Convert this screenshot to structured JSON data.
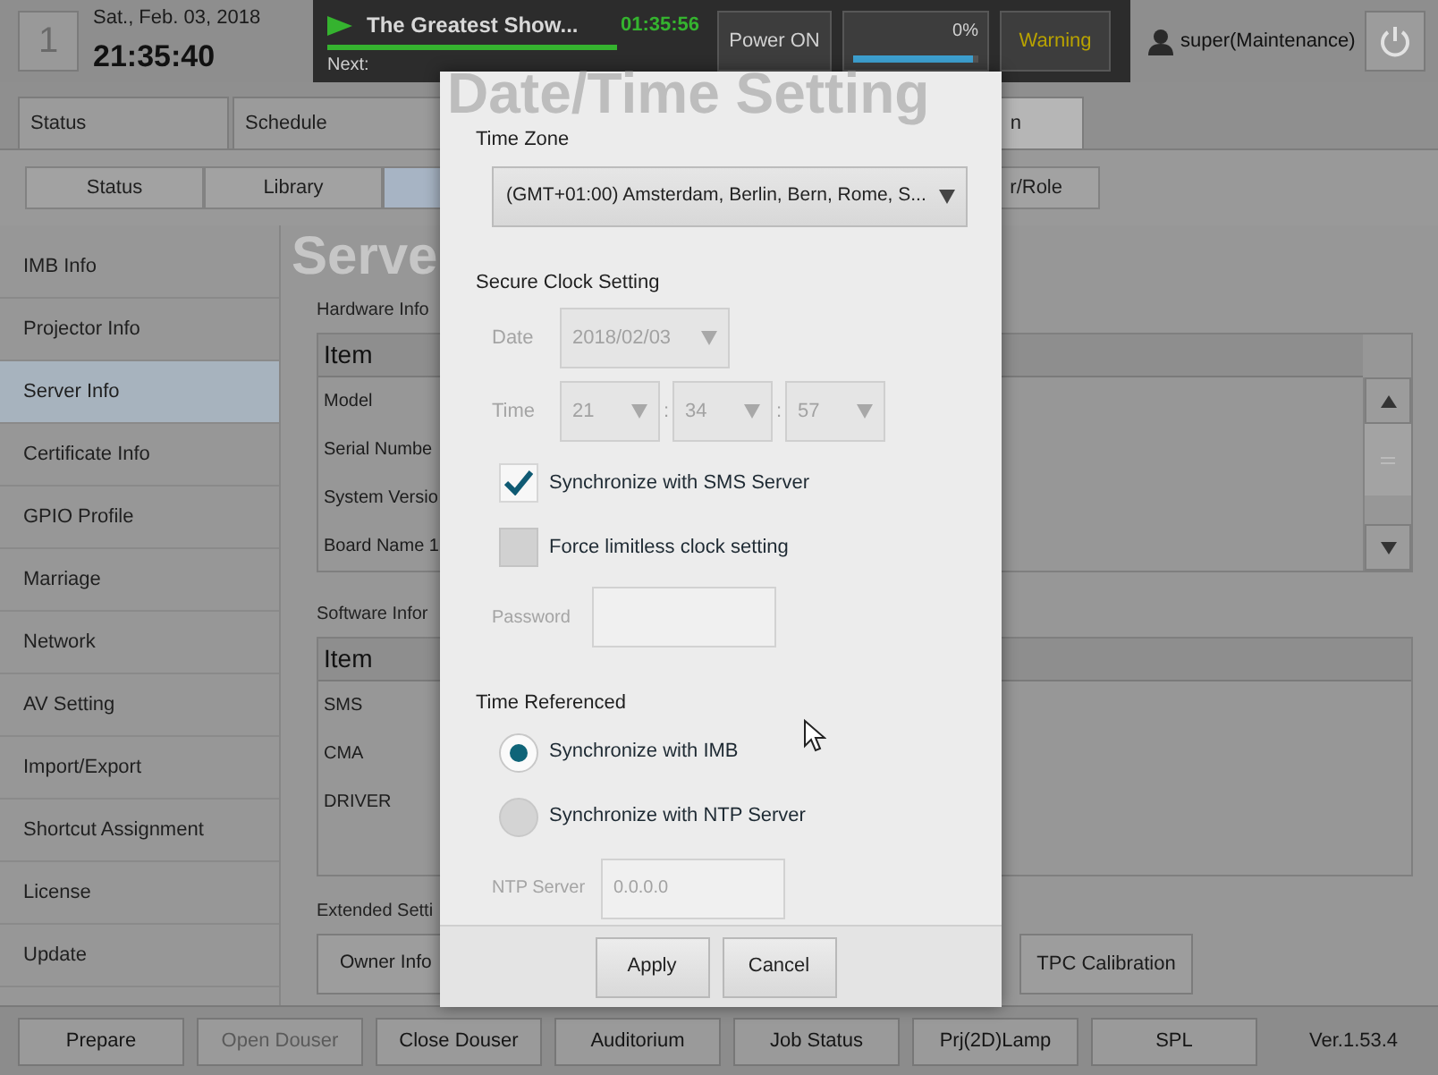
{
  "header": {
    "screen_number": "1",
    "date": "Sat., Feb. 03, 2018",
    "time": "21:35:40",
    "now_playing": {
      "title": "The Greatest Show...",
      "elapsed": "01:35:56",
      "level": 1,
      "next_label": "Next:"
    },
    "power_button": "Power ON",
    "lamp": {
      "reading": "0%",
      "level": 0.95
    },
    "warning": "Warning",
    "user": "super(Maintenance)"
  },
  "main_tabs": [
    {
      "label": "Status",
      "selected": false
    },
    {
      "label": "Schedule",
      "selected": false
    },
    {
      "label": "n",
      "selected": true
    }
  ],
  "sub_tabs": [
    {
      "label": "Status",
      "selected": false
    },
    {
      "label": "Library",
      "selected": false
    },
    {
      "selected": true
    },
    {
      "label": "r/Role",
      "selected": false
    }
  ],
  "sidebar": {
    "items": [
      {
        "label": "IMB Info",
        "selected": false
      },
      {
        "label": "Projector Info",
        "selected": false
      },
      {
        "label": "Server Info",
        "selected": true
      },
      {
        "label": "Certificate Info",
        "selected": false
      },
      {
        "label": "GPIO Profile",
        "selected": false
      },
      {
        "label": "Marriage",
        "selected": false
      },
      {
        "label": "Network",
        "selected": false
      },
      {
        "label": "AV Setting",
        "selected": false
      },
      {
        "label": "Import/Export",
        "selected": false
      },
      {
        "label": "Shortcut Assignment",
        "selected": false
      },
      {
        "label": "License",
        "selected": false
      },
      {
        "label": "Update",
        "selected": false
      }
    ]
  },
  "page_title": "Serve",
  "hardware": {
    "label": "Hardware Info",
    "header": "Item",
    "rows": [
      "Model",
      "Serial Numbe",
      "System Versio",
      "Board Name 1"
    ]
  },
  "software": {
    "label": "Software Infor",
    "header": "Item",
    "rows": [
      "SMS",
      "CMA",
      "DRIVER"
    ]
  },
  "extended": {
    "label": "Extended Setti",
    "buttons": [
      "Owner Info",
      "TPC Calibration"
    ]
  },
  "dialog": {
    "title": "Date/Time Setting",
    "time_zone": {
      "label": "Time Zone",
      "value": "(GMT+01:00) Amsterdam, Berlin, Bern, Rome, S..."
    },
    "secure_clock": {
      "label": "Secure Clock Setting",
      "disabled": true,
      "date_label": "Date",
      "date_value": "2018/02/03",
      "time_label": "Time",
      "time_values": [
        "21",
        "34",
        "57"
      ],
      "separators": [
        ":",
        ":"
      ]
    },
    "checkboxes": [
      {
        "label": "Synchronize with SMS Server",
        "checked": true
      },
      {
        "label": "Force limitless clock setting",
        "checked": false
      }
    ],
    "password": {
      "label": "Password",
      "disabled": true
    },
    "time_referenced": {
      "label": "Time Referenced",
      "options": [
        {
          "label": "Synchronize with IMB",
          "selected": true
        },
        {
          "label": "Synchronize with NTP Server",
          "selected": false
        }
      ]
    },
    "ntp": {
      "label": "NTP Server",
      "value": "0.0.0.0",
      "disabled": true
    },
    "buttons": [
      "Apply",
      "Cancel"
    ]
  },
  "bottom_bar": {
    "buttons": [
      {
        "label": "Prepare",
        "disabled": false
      },
      {
        "label": "Open Douser",
        "disabled": true
      },
      {
        "label": "Close Douser",
        "disabled": false
      },
      {
        "label": "Auditorium",
        "disabled": false
      },
      {
        "label": "Job Status",
        "disabled": false
      },
      {
        "label": "Prj(2D)Lamp",
        "disabled": false
      },
      {
        "label": "SPL",
        "disabled": false
      }
    ],
    "version": "Ver.1.53.4"
  }
}
